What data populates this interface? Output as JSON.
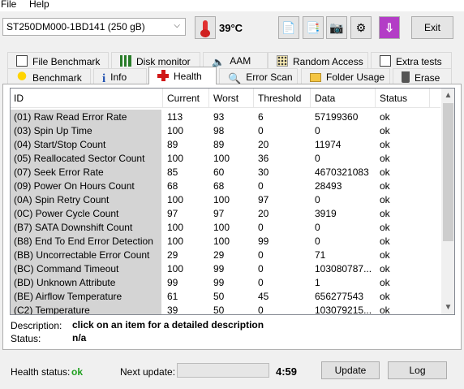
{
  "menu": {
    "file": "File",
    "help": "Help"
  },
  "toolbar": {
    "drive": "ST250DM000-1BD141 (250 gB)",
    "temperature": "39°C",
    "exit_label": "Exit"
  },
  "tabs_row1": [
    {
      "label": "File Benchmark",
      "icon": "file-benchmark-icon"
    },
    {
      "label": "Disk monitor",
      "icon": "disk-monitor-icon"
    },
    {
      "label": "AAM",
      "icon": "speaker-icon"
    },
    {
      "label": "Random Access",
      "icon": "random-access-icon"
    },
    {
      "label": "Extra tests",
      "icon": "extra-tests-icon"
    }
  ],
  "tabs_row2": [
    {
      "label": "Benchmark",
      "icon": "lightbulb-icon"
    },
    {
      "label": "Info",
      "icon": "info-icon"
    },
    {
      "label": "Health",
      "icon": "red-cross-icon",
      "active": true
    },
    {
      "label": "Error Scan",
      "icon": "magnifier-icon"
    },
    {
      "label": "Folder Usage",
      "icon": "folder-icon"
    },
    {
      "label": "Erase",
      "icon": "trash-icon"
    }
  ],
  "table": {
    "headers": [
      "ID",
      "Current",
      "Worst",
      "Threshold",
      "Data",
      "Status"
    ],
    "rows": [
      [
        "(01) Raw Read Error Rate",
        "113",
        "93",
        "6",
        "57199360",
        "ok"
      ],
      [
        "(03) Spin Up Time",
        "100",
        "98",
        "0",
        "0",
        "ok"
      ],
      [
        "(04) Start/Stop Count",
        "89",
        "89",
        "20",
        "11974",
        "ok"
      ],
      [
        "(05) Reallocated Sector Count",
        "100",
        "100",
        "36",
        "0",
        "ok"
      ],
      [
        "(07) Seek Error Rate",
        "85",
        "60",
        "30",
        "4670321083",
        "ok"
      ],
      [
        "(09) Power On Hours Count",
        "68",
        "68",
        "0",
        "28493",
        "ok"
      ],
      [
        "(0A) Spin Retry Count",
        "100",
        "100",
        "97",
        "0",
        "ok"
      ],
      [
        "(0C) Power Cycle Count",
        "97",
        "97",
        "20",
        "3919",
        "ok"
      ],
      [
        "(B7) SATA Downshift Count",
        "100",
        "100",
        "0",
        "0",
        "ok"
      ],
      [
        "(B8) End To End Error Detection",
        "100",
        "100",
        "99",
        "0",
        "ok"
      ],
      [
        "(BB) Uncorrectable Error Count",
        "29",
        "29",
        "0",
        "71",
        "ok"
      ],
      [
        "(BC) Command Timeout",
        "100",
        "99",
        "0",
        "103080787...",
        "ok"
      ],
      [
        "(BD) Unknown Attribute",
        "99",
        "99",
        "0",
        "1",
        "ok"
      ],
      [
        "(BE) Airflow Temperature",
        "61",
        "50",
        "45",
        "656277543",
        "ok"
      ],
      [
        "(C2) Temperature",
        "39",
        "50",
        "0",
        "103079215...",
        "ok"
      ]
    ]
  },
  "description": {
    "label": "Description:",
    "value": "click on an item for a detailed description",
    "status_label": "Status:",
    "status_value": "n/a"
  },
  "footer": {
    "health_label": "Health status:",
    "health_value": "ok",
    "next_update_label": "Next update:",
    "next_update_progress": 0,
    "countdown": "4:59",
    "update_label": "Update",
    "log_label": "Log"
  },
  "colors": {
    "ok_green": "#20a020",
    "accent_purple": "#b33dc6",
    "thermo_red": "#e03030"
  }
}
